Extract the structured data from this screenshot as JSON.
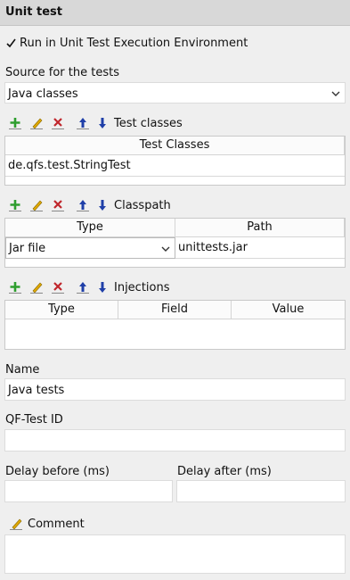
{
  "header": {
    "title": "Unit test"
  },
  "run_env": {
    "label": "Run in Unit Test Execution Environment",
    "checked": true
  },
  "source": {
    "label": "Source for the tests",
    "value": "Java classes"
  },
  "test_classes": {
    "label": "Test classes",
    "header": "Test Classes",
    "rows": [
      "de.qfs.test.StringTest"
    ]
  },
  "classpath": {
    "label": "Classpath",
    "columns": [
      "Type",
      "Path"
    ],
    "rows": [
      {
        "type": "Jar file",
        "path": "unittests.jar"
      }
    ]
  },
  "injections": {
    "label": "Injections",
    "columns": [
      "Type",
      "Field",
      "Value"
    ]
  },
  "name": {
    "label": "Name",
    "value": "Java tests"
  },
  "qftest_id": {
    "label": "QF-Test ID",
    "value": ""
  },
  "delay_before": {
    "label": "Delay before (ms)",
    "value": ""
  },
  "delay_after": {
    "label": "Delay after (ms)",
    "value": ""
  },
  "comment": {
    "label": "Comment",
    "value": ""
  },
  "icons": {
    "add": "plus-icon",
    "edit": "pencil-icon",
    "delete": "delete-icon",
    "up": "arrow-up-icon",
    "down": "arrow-down-icon",
    "colors": {
      "add": "#2e9e2e",
      "delete": "#c0262c",
      "arrow": "#1f3fa8",
      "pencil": "#e0a800"
    }
  }
}
